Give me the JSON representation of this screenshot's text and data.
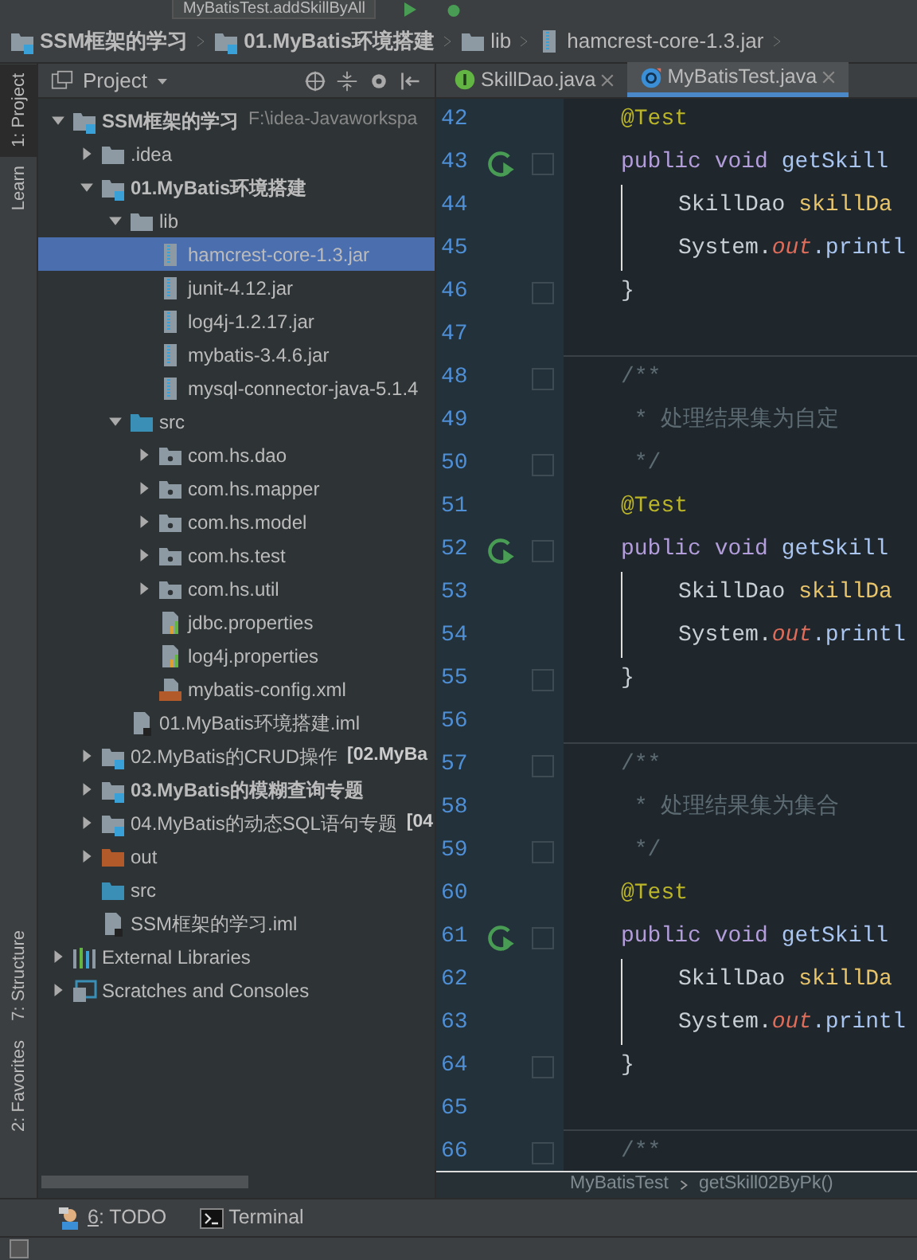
{
  "toolbar": {
    "run_config": "MyBatisTest.addSkillByAll"
  },
  "nav_bar": [
    {
      "label": "SSM框架的学习",
      "kind": "module",
      "bold": true
    },
    {
      "label": "01.MyBatis环境搭建",
      "kind": "module",
      "bold": true
    },
    {
      "label": "lib",
      "kind": "folder",
      "bold": false
    },
    {
      "label": "hamcrest-core-1.3.jar",
      "kind": "jar",
      "bold": false
    }
  ],
  "tool_stripe": {
    "top": [
      {
        "label": "1: Project",
        "selected": true
      },
      {
        "label": "Learn",
        "selected": false
      }
    ],
    "bottom": [
      {
        "label": "7: Structure",
        "selected": false
      },
      {
        "label": "2: Favorites",
        "selected": false
      }
    ]
  },
  "project_panel": {
    "title": "Project",
    "tree": [
      {
        "label": "SSM框架的学习",
        "bold": true,
        "suffix": "F:\\idea-Javaworkspa",
        "kind": "module",
        "expanded": true,
        "selected": false,
        "children": [
          {
            "label": ".idea",
            "kind": "folder",
            "expanded": false,
            "selected": false
          },
          {
            "label": "01.MyBatis环境搭建",
            "bold": true,
            "kind": "module",
            "expanded": true,
            "selected": false,
            "children": [
              {
                "label": "lib",
                "kind": "folder",
                "expanded": true,
                "selected": false,
                "children": [
                  {
                    "label": "hamcrest-core-1.3.jar",
                    "kind": "jar",
                    "selected": true
                  },
                  {
                    "label": "junit-4.12.jar",
                    "kind": "jar",
                    "selected": false
                  },
                  {
                    "label": "log4j-1.2.17.jar",
                    "kind": "jar",
                    "selected": false
                  },
                  {
                    "label": "mybatis-3.4.6.jar",
                    "kind": "jar",
                    "selected": false
                  },
                  {
                    "label": "mysql-connector-java-5.1.4",
                    "kind": "jar",
                    "selected": false
                  }
                ]
              },
              {
                "label": "src",
                "kind": "src",
                "expanded": true,
                "selected": false,
                "children": [
                  {
                    "label": "com.hs.dao",
                    "kind": "package",
                    "expanded": false,
                    "selected": false
                  },
                  {
                    "label": "com.hs.mapper",
                    "kind": "package",
                    "expanded": false,
                    "selected": false
                  },
                  {
                    "label": "com.hs.model",
                    "kind": "package",
                    "expanded": false,
                    "selected": false
                  },
                  {
                    "label": "com.hs.test",
                    "kind": "package",
                    "expanded": false,
                    "selected": false
                  },
                  {
                    "label": "com.hs.util",
                    "kind": "package",
                    "expanded": false,
                    "selected": false
                  },
                  {
                    "label": "jdbc.properties",
                    "kind": "properties",
                    "selected": false
                  },
                  {
                    "label": "log4j.properties",
                    "kind": "properties",
                    "selected": false
                  },
                  {
                    "label": "mybatis-config.xml",
                    "kind": "xml",
                    "selected": false
                  }
                ]
              },
              {
                "label": "01.MyBatis环境搭建.iml",
                "kind": "iml",
                "selected": false
              }
            ]
          },
          {
            "label": "02.MyBatis的CRUD操作",
            "suffix": "[02.MyBa",
            "suffix_bold": true,
            "kind": "module",
            "expanded": false,
            "selected": false
          },
          {
            "label": "03.MyBatis的模糊查询专题",
            "bold": true,
            "kind": "module",
            "expanded": false,
            "selected": false
          },
          {
            "label": "04.MyBatis的动态SQL语句专题",
            "suffix": "[04",
            "suffix_bold": true,
            "kind": "module",
            "expanded": false,
            "selected": false
          },
          {
            "label": "out",
            "kind": "out",
            "expanded": false,
            "selected": false
          },
          {
            "label": "src",
            "kind": "src",
            "selected": false
          },
          {
            "label": "SSM框架的学习.iml",
            "kind": "iml",
            "selected": false
          }
        ]
      },
      {
        "label": "External Libraries",
        "kind": "libraries",
        "expanded": false,
        "selected": false
      },
      {
        "label": "Scratches and Consoles",
        "kind": "scratches",
        "expanded": false,
        "selected": false
      }
    ]
  },
  "editor": {
    "tabs": [
      {
        "label": "SkillDao.java",
        "kind": "interface",
        "selected": false
      },
      {
        "label": "MyBatisTest.java",
        "kind": "class",
        "selected": true
      }
    ],
    "lines": [
      {
        "number": "42",
        "tokens": [
          {
            "text": "@Test",
            "kind": "annotation"
          }
        ]
      },
      {
        "number": "43",
        "run": true,
        "fold": true,
        "tokens": [
          {
            "text": "public",
            "kind": "keyword"
          },
          {
            "text": "void",
            "kind": "keyword"
          },
          {
            "text": "getSkill",
            "kind": "method"
          }
        ]
      },
      {
        "number": "44",
        "guide": true,
        "tokens": [
          {
            "text": "SkillDao",
            "kind": "plain"
          },
          {
            "text": "skillDa",
            "kind": "local"
          }
        ]
      },
      {
        "number": "45",
        "guide": true,
        "tokens": [
          {
            "text": "System.",
            "kind": "plain"
          },
          {
            "text": "out",
            "kind": "static"
          },
          {
            "text": ".printl",
            "kind": "method"
          }
        ]
      },
      {
        "number": "46",
        "fold": true,
        "tokens": [
          {
            "text": "}",
            "kind": "plain"
          }
        ]
      },
      {
        "number": "47",
        "separator": true
      },
      {
        "number": "48",
        "fold": true,
        "tokens": [
          {
            "text": "/**",
            "kind": "comment"
          }
        ]
      },
      {
        "number": "49",
        "tokens": [
          {
            "text": " * 处理结果集为自定",
            "kind": "comment"
          }
        ]
      },
      {
        "number": "50",
        "fold": true,
        "tokens": [
          {
            "text": " */",
            "kind": "comment"
          }
        ]
      },
      {
        "number": "51",
        "tokens": [
          {
            "text": "@Test",
            "kind": "annotation"
          }
        ]
      },
      {
        "number": "52",
        "run": true,
        "fold": true,
        "tokens": [
          {
            "text": "public",
            "kind": "keyword"
          },
          {
            "text": "void",
            "kind": "keyword"
          },
          {
            "text": "getSkill",
            "kind": "method"
          }
        ]
      },
      {
        "number": "53",
        "guide": true,
        "tokens": [
          {
            "text": "SkillDao",
            "kind": "plain"
          },
          {
            "text": "skillDa",
            "kind": "local"
          }
        ]
      },
      {
        "number": "54",
        "guide": true,
        "tokens": [
          {
            "text": "System.",
            "kind": "plain"
          },
          {
            "text": "out",
            "kind": "static"
          },
          {
            "text": ".printl",
            "kind": "method"
          }
        ]
      },
      {
        "number": "55",
        "fold": true,
        "tokens": [
          {
            "text": "}",
            "kind": "plain"
          }
        ]
      },
      {
        "number": "56",
        "separator": true
      },
      {
        "number": "57",
        "fold": true,
        "tokens": [
          {
            "text": "/**",
            "kind": "comment"
          }
        ]
      },
      {
        "number": "58",
        "tokens": [
          {
            "text": " * 处理结果集为集合",
            "kind": "comment"
          }
        ]
      },
      {
        "number": "59",
        "fold": true,
        "tokens": [
          {
            "text": " */",
            "kind": "comment"
          }
        ]
      },
      {
        "number": "60",
        "tokens": [
          {
            "text": "@Test",
            "kind": "annotation"
          }
        ]
      },
      {
        "number": "61",
        "run": true,
        "fold": true,
        "tokens": [
          {
            "text": "public",
            "kind": "keyword"
          },
          {
            "text": "void",
            "kind": "keyword"
          },
          {
            "text": "getSkill",
            "kind": "method"
          }
        ]
      },
      {
        "number": "62",
        "guide": true,
        "tokens": [
          {
            "text": "SkillDao",
            "kind": "plain"
          },
          {
            "text": "skillDa",
            "kind": "local"
          }
        ]
      },
      {
        "number": "63",
        "guide": true,
        "tokens": [
          {
            "text": "System.",
            "kind": "plain"
          },
          {
            "text": "out",
            "kind": "static"
          },
          {
            "text": ".printl",
            "kind": "method"
          }
        ]
      },
      {
        "number": "64",
        "fold": true,
        "tokens": [
          {
            "text": "}",
            "kind": "plain"
          }
        ]
      },
      {
        "number": "65",
        "separator": true
      },
      {
        "number": "66",
        "fold": true,
        "tokens": [
          {
            "text": "/**",
            "kind": "comment"
          }
        ]
      }
    ],
    "breadcrumb": [
      "MyBatisTest",
      "getSkill02ByPk()"
    ]
  },
  "bottom_tools": [
    {
      "number": "6",
      "label": ": TODO",
      "kind": "todo"
    },
    {
      "label": "Terminal",
      "kind": "terminal"
    }
  ]
}
